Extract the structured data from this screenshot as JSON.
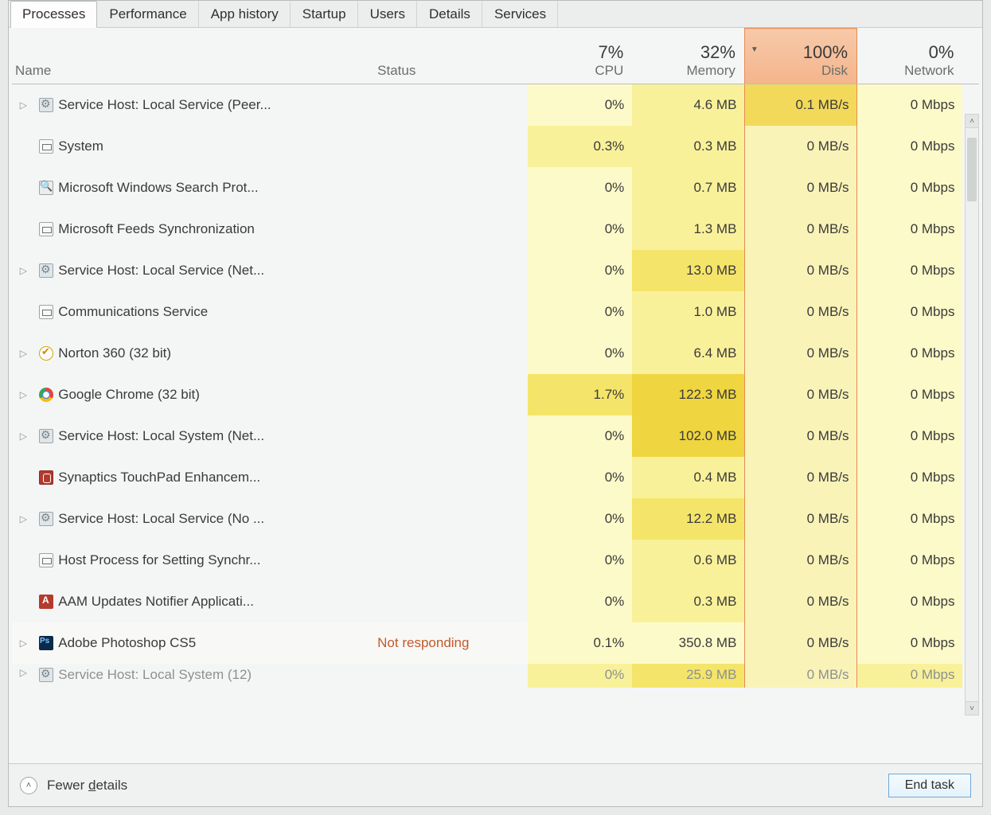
{
  "tabs": [
    "Processes",
    "Performance",
    "App history",
    "Startup",
    "Users",
    "Details",
    "Services"
  ],
  "active_tab": 0,
  "columns": {
    "name": "Name",
    "status": "Status",
    "cpu_pct": "7%",
    "cpu_label": "CPU",
    "mem_pct": "32%",
    "mem_label": "Memory",
    "disk_pct": "100%",
    "disk_label": "Disk",
    "net_pct": "0%",
    "net_label": "Network"
  },
  "rows": [
    {
      "expand": true,
      "icon": "gear",
      "name": "Service Host: Local Service (Peer...",
      "status": "",
      "cpu": "0%",
      "mem": "4.6 MB",
      "disk": "0.1 MB/s",
      "net": "0 Mbps",
      "heat": {
        "cpu": "h0",
        "mem": "h1",
        "disk": "hd-hot",
        "net": "h0"
      }
    },
    {
      "expand": false,
      "icon": "app",
      "name": "System",
      "status": "",
      "cpu": "0.3%",
      "mem": "0.3 MB",
      "disk": "0 MB/s",
      "net": "0 Mbps",
      "heat": {
        "cpu": "h1",
        "mem": "h1",
        "disk": "hd",
        "net": "h0"
      }
    },
    {
      "expand": false,
      "icon": "search",
      "name": "Microsoft Windows Search Prot...",
      "status": "",
      "cpu": "0%",
      "mem": "0.7 MB",
      "disk": "0 MB/s",
      "net": "0 Mbps",
      "heat": {
        "cpu": "h0",
        "mem": "h1",
        "disk": "hd",
        "net": "h0"
      }
    },
    {
      "expand": false,
      "icon": "app",
      "name": "Microsoft Feeds Synchronization",
      "status": "",
      "cpu": "0%",
      "mem": "1.3 MB",
      "disk": "0 MB/s",
      "net": "0 Mbps",
      "heat": {
        "cpu": "h0",
        "mem": "h1",
        "disk": "hd",
        "net": "h0"
      }
    },
    {
      "expand": true,
      "icon": "gear",
      "name": "Service Host: Local Service (Net...",
      "status": "",
      "cpu": "0%",
      "mem": "13.0 MB",
      "disk": "0 MB/s",
      "net": "0 Mbps",
      "heat": {
        "cpu": "h0",
        "mem": "h2",
        "disk": "hd",
        "net": "h0"
      }
    },
    {
      "expand": false,
      "icon": "app",
      "name": "Communications Service",
      "status": "",
      "cpu": "0%",
      "mem": "1.0 MB",
      "disk": "0 MB/s",
      "net": "0 Mbps",
      "heat": {
        "cpu": "h0",
        "mem": "h1",
        "disk": "hd",
        "net": "h0"
      }
    },
    {
      "expand": true,
      "icon": "norton",
      "name": "Norton 360 (32 bit)",
      "status": "",
      "cpu": "0%",
      "mem": "6.4 MB",
      "disk": "0 MB/s",
      "net": "0 Mbps",
      "heat": {
        "cpu": "h0",
        "mem": "h1",
        "disk": "hd",
        "net": "h0"
      }
    },
    {
      "expand": true,
      "icon": "chrome",
      "name": "Google Chrome (32 bit)",
      "status": "",
      "cpu": "1.7%",
      "mem": "122.3 MB",
      "disk": "0 MB/s",
      "net": "0 Mbps",
      "heat": {
        "cpu": "h2",
        "mem": "h3",
        "disk": "hd",
        "net": "h0"
      }
    },
    {
      "expand": true,
      "icon": "gear",
      "name": "Service Host: Local System (Net...",
      "status": "",
      "cpu": "0%",
      "mem": "102.0 MB",
      "disk": "0 MB/s",
      "net": "0 Mbps",
      "heat": {
        "cpu": "h0",
        "mem": "h3",
        "disk": "hd",
        "net": "h0"
      }
    },
    {
      "expand": false,
      "icon": "syn",
      "name": "Synaptics TouchPad Enhancem...",
      "status": "",
      "cpu": "0%",
      "mem": "0.4 MB",
      "disk": "0 MB/s",
      "net": "0 Mbps",
      "heat": {
        "cpu": "h0",
        "mem": "h1",
        "disk": "hd",
        "net": "h0"
      }
    },
    {
      "expand": true,
      "icon": "gear",
      "name": "Service Host: Local Service (No ...",
      "status": "",
      "cpu": "0%",
      "mem": "12.2 MB",
      "disk": "0 MB/s",
      "net": "0 Mbps",
      "heat": {
        "cpu": "h0",
        "mem": "h2",
        "disk": "hd",
        "net": "h0"
      }
    },
    {
      "expand": false,
      "icon": "app",
      "name": "Host Process for Setting Synchr...",
      "status": "",
      "cpu": "0%",
      "mem": "0.6 MB",
      "disk": "0 MB/s",
      "net": "0 Mbps",
      "heat": {
        "cpu": "h0",
        "mem": "h1",
        "disk": "hd",
        "net": "h0"
      }
    },
    {
      "expand": false,
      "icon": "adobe",
      "name": "AAM Updates Notifier Applicati...",
      "status": "",
      "cpu": "0%",
      "mem": "0.3 MB",
      "disk": "0 MB/s",
      "net": "0 Mbps",
      "heat": {
        "cpu": "h0",
        "mem": "h1",
        "disk": "hd",
        "net": "h0"
      }
    },
    {
      "expand": true,
      "icon": "ps",
      "name": "Adobe Photoshop CS5",
      "status": "Not responding",
      "cpu": "0.1%",
      "mem": "350.8 MB",
      "disk": "0 MB/s",
      "net": "0 Mbps",
      "heat": {
        "cpu": "h0",
        "mem": "h0",
        "disk": "hd",
        "net": "h0"
      },
      "sel": true
    },
    {
      "expand": true,
      "icon": "gear",
      "name": "Service Host: Local System (12)",
      "status": "",
      "cpu": "0%",
      "mem": "25.9 MB",
      "disk": "0 MB/s",
      "net": "0 Mbps",
      "heat": {
        "cpu": "h1",
        "mem": "h2",
        "disk": "hd",
        "net": "h1"
      },
      "partial": true
    }
  ],
  "footer": {
    "fewer": "Fewer details",
    "endtask": "End task"
  }
}
